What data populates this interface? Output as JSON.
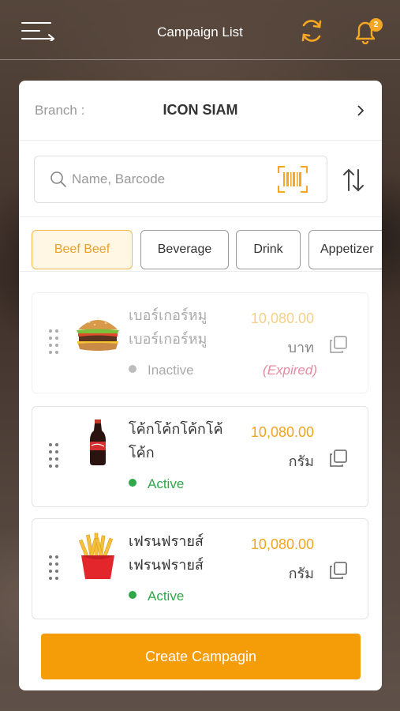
{
  "header": {
    "title": "Campaign List",
    "notification_count": "2",
    "accent_color": "#f5a623"
  },
  "branch": {
    "label": "Branch :",
    "value": "ICON SIAM"
  },
  "search": {
    "placeholder": "Name, Barcode",
    "value": ""
  },
  "filters": [
    {
      "label": "Beef Beef",
      "selected": true
    },
    {
      "label": "Beverage",
      "selected": false
    },
    {
      "label": "Drink",
      "selected": false
    },
    {
      "label": "Appetizer",
      "selected": false
    }
  ],
  "items": [
    {
      "name_line1": "เบอร์เกอร์หมู",
      "name_line2": "เบอร์เกอร์หมู",
      "price": "10,080.00",
      "unit": "บาท",
      "status": "Inactive",
      "note": "(Expired)",
      "image_icon": "burger-icon"
    },
    {
      "name_line1": "โค้กโค้กโค้กโค้",
      "name_line2": "โค้ก",
      "price": "10,080.00",
      "unit": "กรัม",
      "status": "Active",
      "note": "",
      "image_icon": "cola-bottle-icon"
    },
    {
      "name_line1": "เฟรนฟรายส์",
      "name_line2": "เฟรนฟรายส์",
      "price": "10,080.00",
      "unit": "กรัม",
      "status": "Active",
      "note": "",
      "image_icon": "french-fries-icon"
    }
  ],
  "actions": {
    "create_label": "Create Campagin"
  },
  "colors": {
    "active": "#2ea84a",
    "inactive": "#bdbdbd",
    "price": "#f0a51e",
    "button": "#f59c09"
  }
}
